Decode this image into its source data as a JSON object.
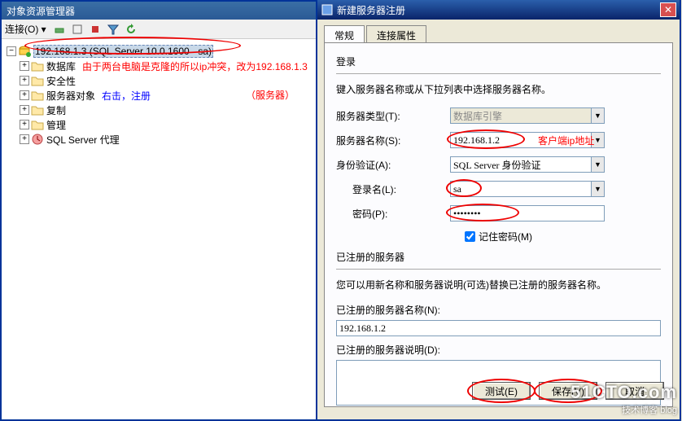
{
  "mgr": {
    "title": "对象资源管理器",
    "toolbar_label": "连接(O) ▾",
    "root": "192.168.1.3 (SQL Server 10.0.1600 - sa)",
    "nodes": [
      {
        "label": "数据库"
      },
      {
        "label": "安全性"
      },
      {
        "label": "服务器对象"
      },
      {
        "label": "复制"
      },
      {
        "label": "管理"
      },
      {
        "label": "SQL Server 代理"
      }
    ],
    "anno_red1": "由于两台电脑是克隆的所以ip冲突，改为192.168.1.3",
    "anno_blue": "右击，注册",
    "anno_red2": "（服务器）"
  },
  "dlg": {
    "title": "新建服务器注册",
    "tabs": {
      "t1": "常规",
      "t2": "连接属性"
    },
    "section_login": "登录",
    "desc": "键入服务器名称或从下拉列表中选择服务器名称。",
    "lbl_server_type": "服务器类型(T):",
    "val_server_type": "数据库引擎",
    "lbl_server_name": "服务器名称(S):",
    "val_server_name": "192.168.1.2",
    "anno_client_ip": "客户端ip地址",
    "lbl_auth": "身份验证(A):",
    "val_auth": "SQL Server 身份验证",
    "lbl_login": "登录名(L):",
    "val_login": "sa",
    "lbl_pwd": "密码(P):",
    "val_pwd": "********",
    "chk_remember": "记住密码(M)",
    "section_reg": "已注册的服务器",
    "reg_desc": "您可以用新名称和服务器说明(可选)替换已注册的服务器名称。",
    "lbl_reg_name": "已注册的服务器名称(N):",
    "val_reg_name": "192.168.1.2",
    "lbl_reg_desc": "已注册的服务器说明(D):",
    "btn_test": "测试(E)",
    "btn_save": "保存(V)",
    "btn_cancel": "取消"
  },
  "watermark": {
    "line1": "51CTO.com",
    "line2": "技术博客  blog"
  }
}
